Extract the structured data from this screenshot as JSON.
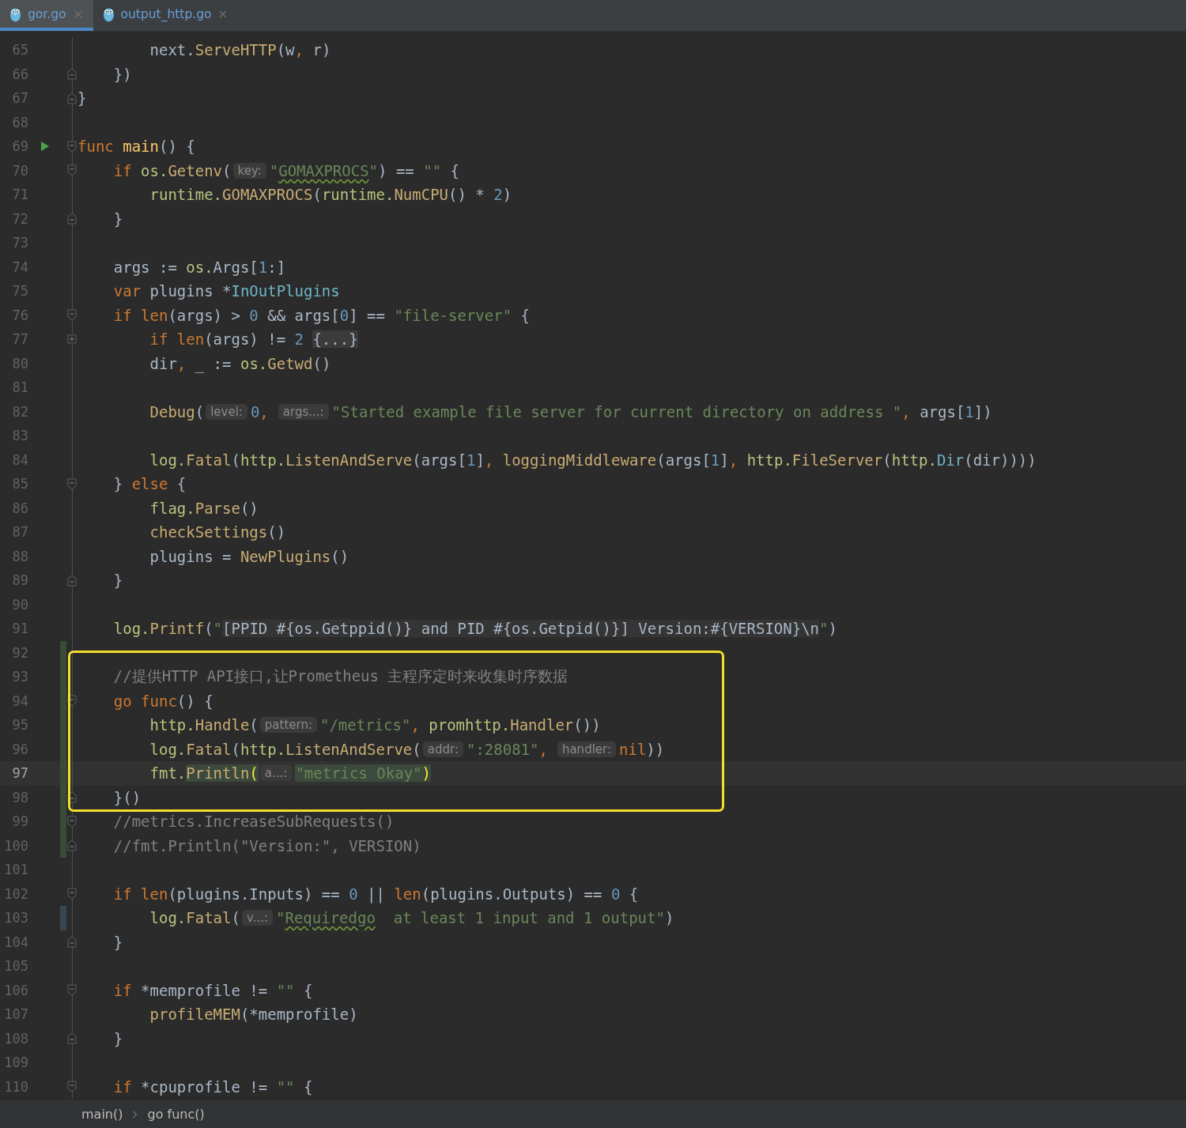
{
  "tabs": [
    {
      "label": "gor.go",
      "selected": true
    },
    {
      "label": "output_http.go",
      "selected": false
    }
  ],
  "editor": {
    "blocks": [
      {
        "lines": [
          {
            "number": "65",
            "tokens": [
              {
                "kind": "plain",
                "text": "        next."
              },
              {
                "kind": "fn",
                "text": "ServeHTTP"
              },
              {
                "kind": "plain",
                "text": "(w"
              },
              {
                "kind": "punct",
                "text": ","
              },
              {
                "kind": "plain",
                "text": " r)"
              }
            ]
          },
          {
            "number": "66",
            "fold_end": true,
            "tokens": [
              {
                "kind": "plain",
                "text": "    })"
              }
            ]
          },
          {
            "number": "67",
            "fold_end": true,
            "tokens": [
              {
                "kind": "plain",
                "text": "}"
              }
            ]
          },
          {
            "number": "68"
          },
          {
            "number": "69",
            "run": true,
            "fold_start": true,
            "tokens": [
              {
                "kind": "kw",
                "text": "func "
              },
              {
                "kind": "decl",
                "text": "main"
              },
              {
                "kind": "plain",
                "text": "() {"
              }
            ]
          },
          {
            "number": "70",
            "fold_start": true,
            "tokens": [
              {
                "kind": "kw",
                "text": "    if "
              },
              {
                "kind": "pkg",
                "text": "os."
              },
              {
                "kind": "fn",
                "text": "Getenv"
              },
              {
                "kind": "plain",
                "text": "("
              },
              {
                "kind": "hint",
                "text": "key:"
              },
              {
                "kind": "str",
                "text": "\""
              },
              {
                "kind": "str",
                "text": "GOMAXPROCS",
                "typo": true
              },
              {
                "kind": "str",
                "text": "\""
              },
              {
                "kind": "plain",
                "text": ") == "
              },
              {
                "kind": "str",
                "text": "\"\""
              },
              {
                "kind": "plain",
                "text": " {"
              }
            ]
          },
          {
            "number": "71",
            "tokens": [
              {
                "kind": "pkg",
                "text": "        runtime."
              },
              {
                "kind": "fn",
                "text": "GOMAXPROCS"
              },
              {
                "kind": "plain",
                "text": "("
              },
              {
                "kind": "pkg",
                "text": "runtime."
              },
              {
                "kind": "fn",
                "text": "NumCPU"
              },
              {
                "kind": "plain",
                "text": "() * "
              },
              {
                "kind": "num",
                "text": "2"
              },
              {
                "kind": "plain",
                "text": ")"
              }
            ]
          },
          {
            "number": "72",
            "fold_end": true,
            "tokens": [
              {
                "kind": "plain",
                "text": "    }"
              }
            ]
          },
          {
            "number": "73"
          },
          {
            "number": "74",
            "tokens": [
              {
                "kind": "plain",
                "text": "    args := "
              },
              {
                "kind": "pkg",
                "text": "os."
              },
              {
                "kind": "plain",
                "text": "Args["
              },
              {
                "kind": "num",
                "text": "1"
              },
              {
                "kind": "plain",
                "text": ":]"
              }
            ]
          },
          {
            "number": "75",
            "tokens": [
              {
                "kind": "kw",
                "text": "    var"
              },
              {
                "kind": "plain",
                "text": " plugins *"
              },
              {
                "kind": "type",
                "text": "InOutPlugins"
              }
            ]
          },
          {
            "number": "76",
            "fold_start": true,
            "tokens": [
              {
                "kind": "kw",
                "text": "    if len"
              },
              {
                "kind": "plain",
                "text": "(args) > "
              },
              {
                "kind": "num",
                "text": "0"
              },
              {
                "kind": "plain",
                "text": " && args["
              },
              {
                "kind": "num",
                "text": "0"
              },
              {
                "kind": "plain",
                "text": "] == "
              },
              {
                "kind": "str",
                "text": "\"file-server\""
              },
              {
                "kind": "plain",
                "text": " {"
              }
            ]
          },
          {
            "number": "77",
            "collapsed": true,
            "tokens": [
              {
                "kind": "kw",
                "text": "        if len"
              },
              {
                "kind": "plain",
                "text": "(args) != "
              },
              {
                "kind": "num",
                "text": "2"
              },
              {
                "kind": "folded",
                "text": "{...}"
              }
            ]
          },
          {
            "number": "80",
            "tokens": [
              {
                "kind": "plain",
                "text": "        dir"
              },
              {
                "kind": "punct",
                "text": ","
              },
              {
                "kind": "plain",
                "text": " _ := "
              },
              {
                "kind": "pkg",
                "text": "os."
              },
              {
                "kind": "fn",
                "text": "Getwd"
              },
              {
                "kind": "plain",
                "text": "()"
              }
            ]
          },
          {
            "number": "81"
          },
          {
            "number": "82",
            "tokens": [
              {
                "kind": "fn",
                "text": "        Debug"
              },
              {
                "kind": "plain",
                "text": "("
              },
              {
                "kind": "hint",
                "text": "level:"
              },
              {
                "kind": "num",
                "text": "0"
              },
              {
                "kind": "punct",
                "text": ","
              },
              {
                "kind": "hint",
                "text": "args...:"
              },
              {
                "kind": "str",
                "text": "\"Started example file server for current directory on address \""
              },
              {
                "kind": "punct",
                "text": ","
              },
              {
                "kind": "plain",
                "text": " args["
              },
              {
                "kind": "num",
                "text": "1"
              },
              {
                "kind": "plain",
                "text": "])"
              }
            ]
          },
          {
            "number": "83"
          },
          {
            "number": "84",
            "tokens": [
              {
                "kind": "pkg",
                "text": "        log."
              },
              {
                "kind": "fn",
                "text": "Fatal"
              },
              {
                "kind": "plain",
                "text": "("
              },
              {
                "kind": "pkg",
                "text": "http."
              },
              {
                "kind": "fn",
                "text": "ListenAndServe"
              },
              {
                "kind": "plain",
                "text": "(args["
              },
              {
                "kind": "num",
                "text": "1"
              },
              {
                "kind": "plain",
                "text": "]"
              },
              {
                "kind": "punct",
                "text": ","
              },
              {
                "kind": "fn",
                "text": " loggingMiddleware"
              },
              {
                "kind": "plain",
                "text": "(args["
              },
              {
                "kind": "num",
                "text": "1"
              },
              {
                "kind": "plain",
                "text": "]"
              },
              {
                "kind": "punct",
                "text": ","
              },
              {
                "kind": "pkg",
                "text": " http."
              },
              {
                "kind": "fn",
                "text": "FileServer"
              },
              {
                "kind": "plain",
                "text": "("
              },
              {
                "kind": "pkg",
                "text": "http."
              },
              {
                "kind": "type",
                "text": "Dir"
              },
              {
                "kind": "plain",
                "text": "(dir))))"
              }
            ]
          },
          {
            "number": "85",
            "fold_start": true,
            "tokens": [
              {
                "kind": "plain",
                "text": "    } "
              },
              {
                "kind": "kw",
                "text": "else"
              },
              {
                "kind": "plain",
                "text": " {"
              }
            ]
          },
          {
            "number": "86",
            "tokens": [
              {
                "kind": "pkg",
                "text": "        flag."
              },
              {
                "kind": "fn",
                "text": "Parse"
              },
              {
                "kind": "plain",
                "text": "()"
              }
            ]
          },
          {
            "number": "87",
            "tokens": [
              {
                "kind": "fn",
                "text": "        checkSettings"
              },
              {
                "kind": "plain",
                "text": "()"
              }
            ]
          },
          {
            "number": "88",
            "tokens": [
              {
                "kind": "plain",
                "text": "        plugins = "
              },
              {
                "kind": "fn",
                "text": "NewPlugins"
              },
              {
                "kind": "plain",
                "text": "()"
              }
            ]
          },
          {
            "number": "89",
            "fold_end": true,
            "tokens": [
              {
                "kind": "plain",
                "text": "    }"
              }
            ]
          },
          {
            "number": "90"
          },
          {
            "number": "91",
            "tokens": [
              {
                "kind": "pkg",
                "text": "    log."
              },
              {
                "kind": "fn",
                "text": "Printf"
              },
              {
                "kind": "plain",
                "text": "("
              },
              {
                "kind": "str",
                "text": "\""
              },
              {
                "kind": "inject",
                "text": "[PPID #{os.Getppid()} and PID #{os.Getpid()}] Version:#{VERSION}\\n"
              },
              {
                "kind": "str",
                "text": "\""
              },
              {
                "kind": "plain",
                "text": ")"
              }
            ]
          },
          {
            "number": "92",
            "added": true
          }
        ]
      },
      {
        "boxed": true,
        "lines": [
          {
            "number": "93",
            "added": true,
            "tokens": [
              {
                "kind": "comment",
                "text": "    //提供HTTP API接口,让Prometheus 主程序定时来收集时序数据"
              }
            ]
          },
          {
            "number": "94",
            "added": true,
            "fold_start": true,
            "tokens": [
              {
                "kind": "kw",
                "text": "    go func"
              },
              {
                "kind": "plain",
                "text": "() {"
              }
            ]
          },
          {
            "number": "95",
            "added": true,
            "tokens": [
              {
                "kind": "pkg",
                "text": "        http."
              },
              {
                "kind": "fn",
                "text": "Handle"
              },
              {
                "kind": "plain",
                "text": "("
              },
              {
                "kind": "hint",
                "text": "pattern:"
              },
              {
                "kind": "str",
                "text": "\"/metrics\""
              },
              {
                "kind": "punct",
                "text": ","
              },
              {
                "kind": "pkg",
                "text": " promhttp."
              },
              {
                "kind": "fn",
                "text": "Handler"
              },
              {
                "kind": "plain",
                "text": "())"
              }
            ]
          },
          {
            "number": "96",
            "added": true,
            "tokens": [
              {
                "kind": "pkg",
                "text": "        log."
              },
              {
                "kind": "fn",
                "text": "Fatal"
              },
              {
                "kind": "plain",
                "text": "("
              },
              {
                "kind": "pkg",
                "text": "http."
              },
              {
                "kind": "fn",
                "text": "ListenAndServe"
              },
              {
                "kind": "plain",
                "text": "("
              },
              {
                "kind": "hint",
                "text": "addr:"
              },
              {
                "kind": "str",
                "text": "\":28081\""
              },
              {
                "kind": "punct",
                "text": ","
              },
              {
                "kind": "hint",
                "text": "handler:"
              },
              {
                "kind": "kw",
                "text": "nil"
              },
              {
                "kind": "plain",
                "text": "))"
              }
            ]
          },
          {
            "number": "97",
            "added": true,
            "current": true,
            "tokens": [
              {
                "kind": "pkg",
                "text": "        fmt."
              },
              {
                "kind": "fn",
                "text": "Println",
                "marked": true
              },
              {
                "kind": "paren",
                "text": "(",
                "marked": true
              },
              {
                "kind": "hint",
                "text": "a...:"
              },
              {
                "kind": "str",
                "text": "\"metrics Okay\"",
                "marked": true
              },
              {
                "kind": "paren",
                "text": ")",
                "marked": true
              }
            ]
          },
          {
            "number": "98",
            "added": true,
            "fold_end": true,
            "tokens": [
              {
                "kind": "plain",
                "text": "    }()"
              }
            ]
          }
        ]
      },
      {
        "lines": [
          {
            "number": "99",
            "added": true,
            "fold_start": true,
            "tokens": [
              {
                "kind": "comment",
                "text": "    //metrics.IncreaseSubRequests()"
              }
            ]
          },
          {
            "number": "100",
            "added": true,
            "fold_end": true,
            "tokens": [
              {
                "kind": "comment",
                "text": "    //fmt.Println(\"Version:\", VERSION)"
              }
            ]
          },
          {
            "number": "101"
          },
          {
            "number": "102",
            "fold_start": true,
            "tokens": [
              {
                "kind": "kw",
                "text": "    if len"
              },
              {
                "kind": "plain",
                "text": "(plugins.Inputs) == "
              },
              {
                "kind": "num",
                "text": "0"
              },
              {
                "kind": "plain",
                "text": " || "
              },
              {
                "kind": "kw",
                "text": "len"
              },
              {
                "kind": "plain",
                "text": "(plugins.Outputs) == "
              },
              {
                "kind": "num",
                "text": "0"
              },
              {
                "kind": "plain",
                "text": " {"
              }
            ]
          },
          {
            "number": "103",
            "modified": true,
            "tokens": [
              {
                "kind": "pkg",
                "text": "        log."
              },
              {
                "kind": "fn",
                "text": "Fatal"
              },
              {
                "kind": "plain",
                "text": "("
              },
              {
                "kind": "hint",
                "text": "v...:"
              },
              {
                "kind": "str",
                "text": "\""
              },
              {
                "kind": "str",
                "text": "Requiredgo",
                "typo": true
              },
              {
                "kind": "str",
                "text": "  at least 1 input and 1 output\""
              },
              {
                "kind": "plain",
                "text": ")"
              }
            ]
          },
          {
            "number": "104",
            "fold_end": true,
            "tokens": [
              {
                "kind": "plain",
                "text": "    }"
              }
            ]
          },
          {
            "number": "105"
          },
          {
            "number": "106",
            "fold_start": true,
            "tokens": [
              {
                "kind": "kw",
                "text": "    if"
              },
              {
                "kind": "plain",
                "text": " *memprofile != "
              },
              {
                "kind": "str",
                "text": "\"\""
              },
              {
                "kind": "plain",
                "text": " {"
              }
            ]
          },
          {
            "number": "107",
            "tokens": [
              {
                "kind": "fn",
                "text": "        profileMEM"
              },
              {
                "kind": "plain",
                "text": "(*memprofile)"
              }
            ]
          },
          {
            "number": "108",
            "fold_end": true,
            "tokens": [
              {
                "kind": "plain",
                "text": "    }"
              }
            ]
          },
          {
            "number": "109"
          },
          {
            "number": "110",
            "fold_start": true,
            "tokens": [
              {
                "kind": "kw",
                "text": "    if"
              },
              {
                "kind": "plain",
                "text": " *cpuprofile != "
              },
              {
                "kind": "str",
                "text": "\"\""
              },
              {
                "kind": "plain",
                "text": " {"
              }
            ]
          }
        ]
      }
    ]
  },
  "breadcrumbs": [
    "main()",
    "go func()"
  ]
}
